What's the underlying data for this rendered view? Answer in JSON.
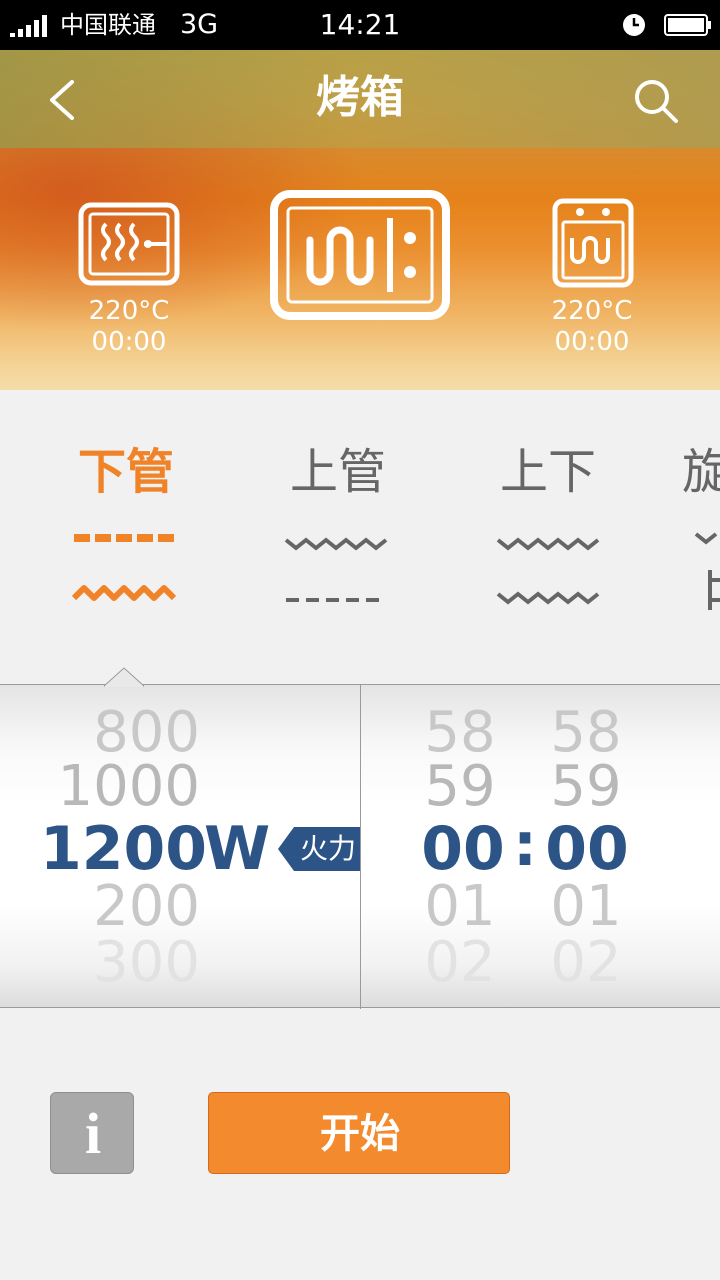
{
  "status_bar": {
    "carrier": "中国联通",
    "network": "3G",
    "time": "14:21"
  },
  "header": {
    "title": "烤箱",
    "back_icon": "chevron-left-icon",
    "search_icon": "search-icon"
  },
  "ovens": {
    "left": {
      "temp": "220°C",
      "time": "00:00"
    },
    "right": {
      "temp": "220°C",
      "time": "00:00"
    }
  },
  "modes": [
    {
      "label": "下管",
      "active": true
    },
    {
      "label": "上管",
      "active": false
    },
    {
      "label": "上下",
      "active": false
    },
    {
      "label": "旋",
      "active": false
    }
  ],
  "picker": {
    "power": {
      "above2": "800",
      "above1": "1000",
      "selected": "1200",
      "unit": "W",
      "below1": "200",
      "below2": "300"
    },
    "fire_label": "火力",
    "hours": {
      "above2": "58",
      "above1": "59",
      "selected": "00",
      "below1": "01",
      "below2": "02"
    },
    "separator": ":",
    "minutes": {
      "above2": "58",
      "above1": "59",
      "selected": "00",
      "below1": "01",
      "below2": "02"
    }
  },
  "buttons": {
    "info": "i",
    "start": "开始"
  },
  "colors": {
    "accent_orange": "#f08228",
    "selected_blue": "#2c5486",
    "mode_grey": "#666666"
  }
}
